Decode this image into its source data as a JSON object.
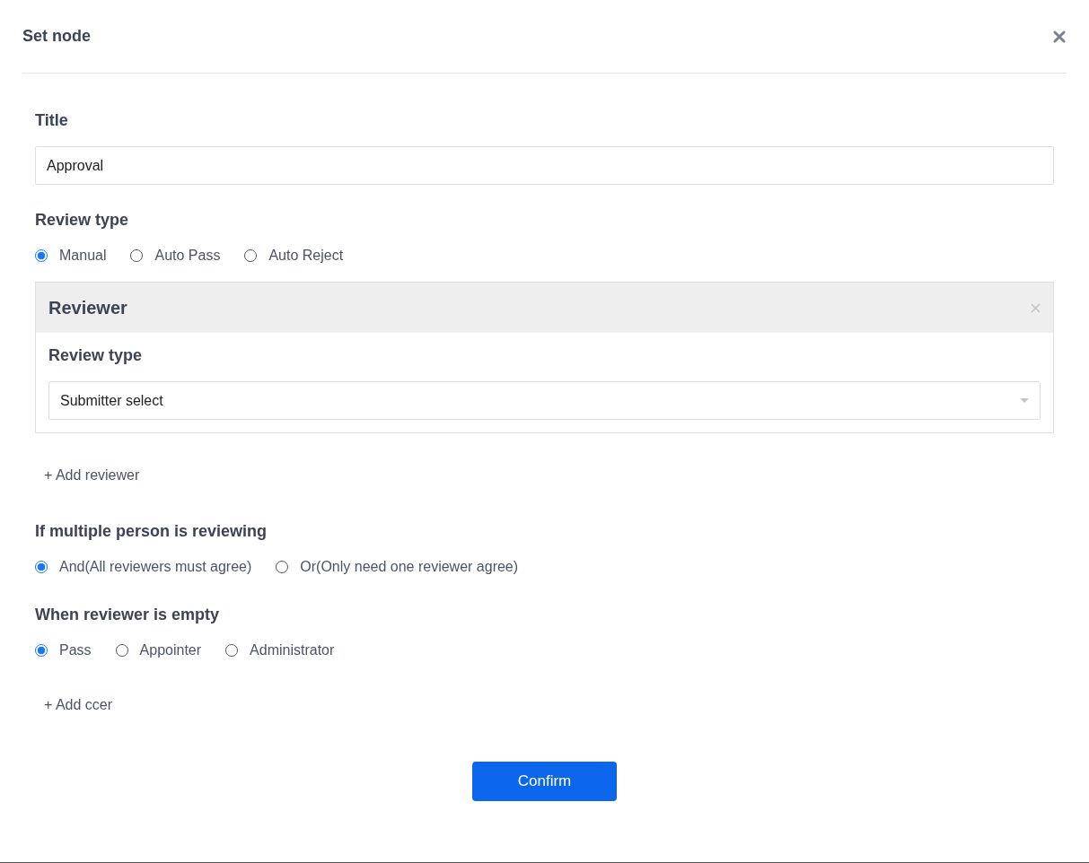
{
  "dialog": {
    "title": "Set node"
  },
  "title_field": {
    "label": "Title",
    "value": "Approval"
  },
  "review_type": {
    "label": "Review type",
    "options": [
      {
        "label": "Manual",
        "selected": true
      },
      {
        "label": "Auto Pass",
        "selected": false
      },
      {
        "label": "Auto Reject",
        "selected": false
      }
    ]
  },
  "reviewer_card": {
    "title": "Reviewer",
    "field_label": "Review type",
    "select_value": "Submitter select"
  },
  "add_reviewer": "+ Add reviewer",
  "multiple_review": {
    "label": "If multiple person is reviewing",
    "options": [
      {
        "label": "And(All reviewers must agree)",
        "selected": true
      },
      {
        "label": "Or(Only need one reviewer agree)",
        "selected": false
      }
    ]
  },
  "empty_reviewer": {
    "label": "When reviewer is empty",
    "options": [
      {
        "label": "Pass",
        "selected": true
      },
      {
        "label": "Appointer",
        "selected": false
      },
      {
        "label": "Administrator",
        "selected": false
      }
    ]
  },
  "add_ccer": "+ Add ccer",
  "confirm_button": "Confirm"
}
